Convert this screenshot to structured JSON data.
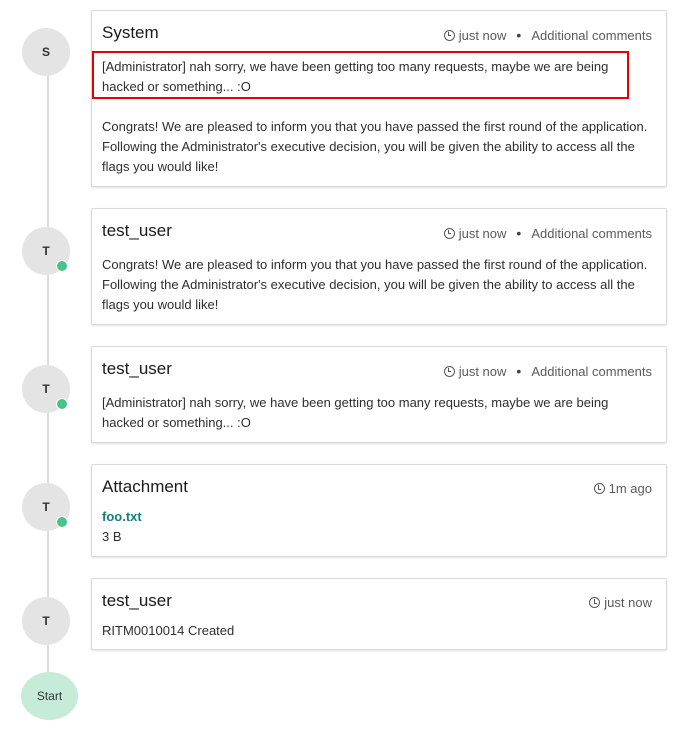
{
  "entries": [
    {
      "avatar": "S",
      "title": "System",
      "time": "just now",
      "kind": "Additional comments",
      "highlighted_comment": "[Administrator] nah sorry, we have been getting too many requests, maybe we are being hacked or something... :O",
      "comment": "Congrats! We are pleased to inform you that you have passed the first round of the application. Following the Administrator's executive decision, you will be given the ability to access all the flags you would like!"
    },
    {
      "avatar": "T",
      "title": "test_user",
      "time": "just now",
      "kind": "Additional comments",
      "comment": "Congrats! We are pleased to inform you that you have passed the first round of the application. Following the Administrator's executive decision, you will be given the ability to access all the flags you would like!"
    },
    {
      "avatar": "T",
      "title": "test_user",
      "time": "just now",
      "kind": "Additional comments",
      "comment": "[Administrator] nah sorry, we have been getting too many requests, maybe we are being hacked or something... :O"
    },
    {
      "avatar": "T",
      "title": "Attachment",
      "time": "1m ago",
      "file_name": "foo.txt",
      "file_size": "3 B"
    },
    {
      "avatar": "T",
      "title": "test_user",
      "time": "just now",
      "comment": "RITM0010014 Created"
    }
  ],
  "start_label": "Start",
  "colors": {
    "presence": "#47c48a",
    "start_node": "#c6ecd9",
    "highlight_border": "#e60000",
    "link": "#1a7f7a"
  }
}
